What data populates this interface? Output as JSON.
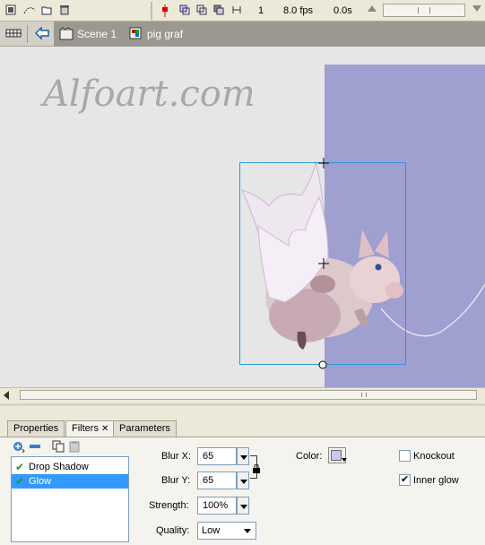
{
  "timeline": {
    "frame": "1",
    "fps": "8.0 fps",
    "time": "0.0s"
  },
  "editbar": {
    "scene": "Scene 1",
    "symbol": "pig graf"
  },
  "stage": {
    "watermark": "Alfoart.com",
    "background_color": "#e6e6e6",
    "rect_color": "#9f9fd0"
  },
  "panel": {
    "tabs": [
      "Properties",
      "Filters",
      "Parameters"
    ],
    "active_tab": "Filters",
    "filters": [
      {
        "label": "Drop Shadow",
        "checked": true,
        "selected": false
      },
      {
        "label": "Glow",
        "checked": true,
        "selected": true
      }
    ],
    "blur_x_label": "Blur X:",
    "blur_x_value": "65",
    "blur_y_label": "Blur Y:",
    "blur_y_value": "65",
    "strength_label": "Strength:",
    "strength_value": "100%",
    "quality_label": "Quality:",
    "quality_value": "Low",
    "color_label": "Color:",
    "color_value": "#c8c8f0",
    "knockout_label": "Knockout",
    "knockout_checked": false,
    "inner_glow_label": "Inner glow",
    "inner_glow_checked": true
  }
}
